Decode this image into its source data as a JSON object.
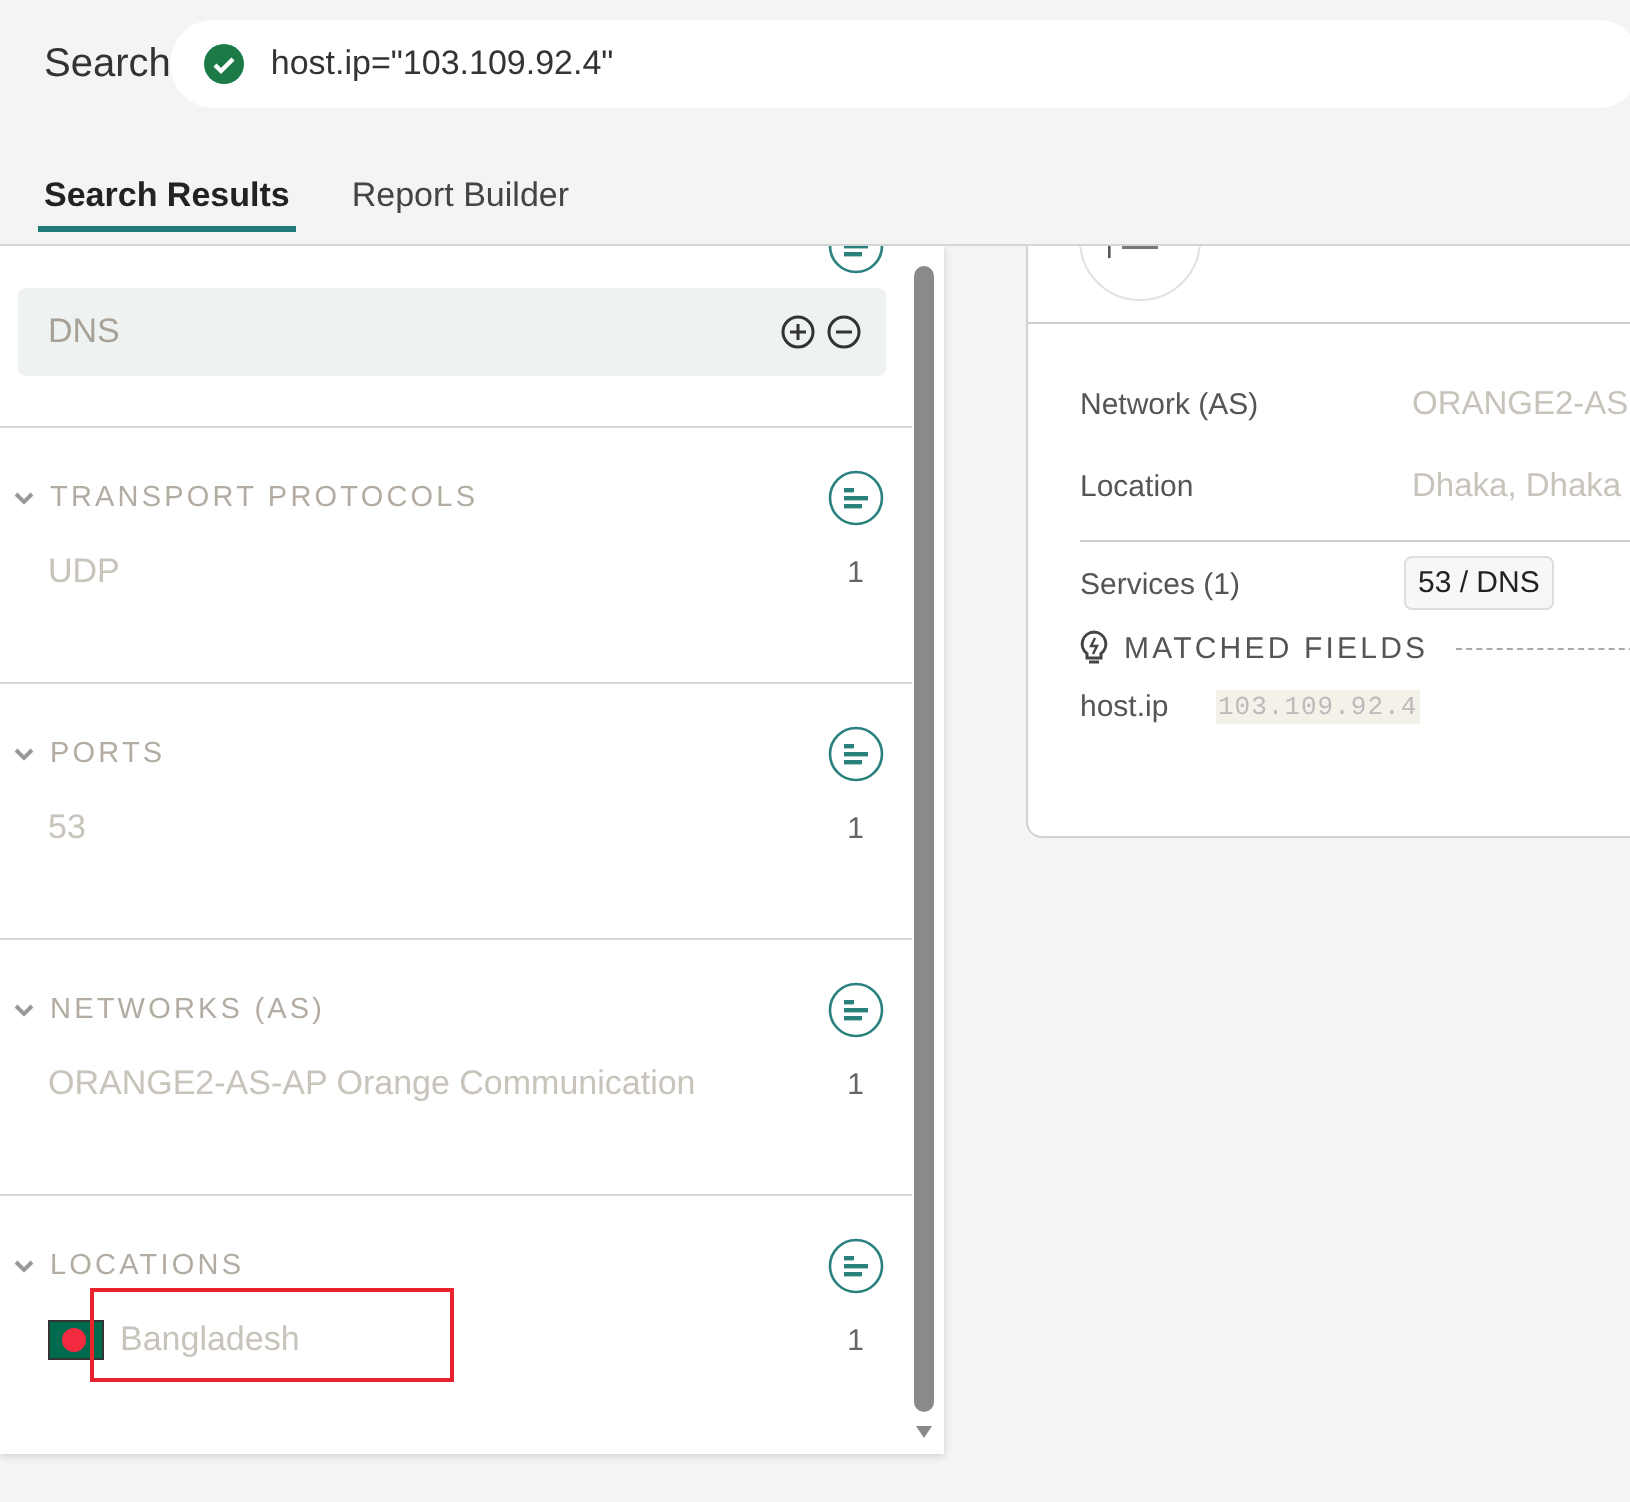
{
  "search": {
    "label": "Search",
    "query": "host.ip=\"103.109.92.4\"",
    "valid": true
  },
  "tabs": [
    {
      "label": "Search Results",
      "selected": true
    },
    {
      "label": "Report Builder",
      "selected": false
    }
  ],
  "facets": {
    "top_item": {
      "label": "DNS"
    },
    "sections": [
      {
        "title": "TRANSPORT PROTOCOLS",
        "expanded": true,
        "items": [
          {
            "kind": "text",
            "label": "UDP",
            "count": "1",
            "highlighted": false
          }
        ]
      },
      {
        "title": "PORTS",
        "expanded": true,
        "items": [
          {
            "kind": "text",
            "label": "53",
            "count": "1",
            "highlighted": false
          }
        ]
      },
      {
        "title": "NETWORKS (AS)",
        "expanded": true,
        "items": [
          {
            "kind": "text",
            "label": "ORANGE2-AS-AP Orange Communication",
            "count": "1",
            "highlighted": false
          }
        ]
      },
      {
        "title": "LOCATIONS",
        "expanded": true,
        "items": [
          {
            "kind": "flag",
            "label": "Bangladesh",
            "count": "1",
            "highlighted": true
          }
        ]
      }
    ]
  },
  "host_card": {
    "fields": [
      {
        "label": "Network (AS)",
        "value": "ORANGE2-AS"
      },
      {
        "label": "Location",
        "value": "Dhaka, Dhaka"
      }
    ],
    "services_label": "Services (1)",
    "services": [
      "53 / DNS"
    ],
    "matched_title": "MATCHED FIELDS",
    "matched": [
      {
        "field": "host.ip",
        "value": "103.109.92.4"
      }
    ]
  }
}
